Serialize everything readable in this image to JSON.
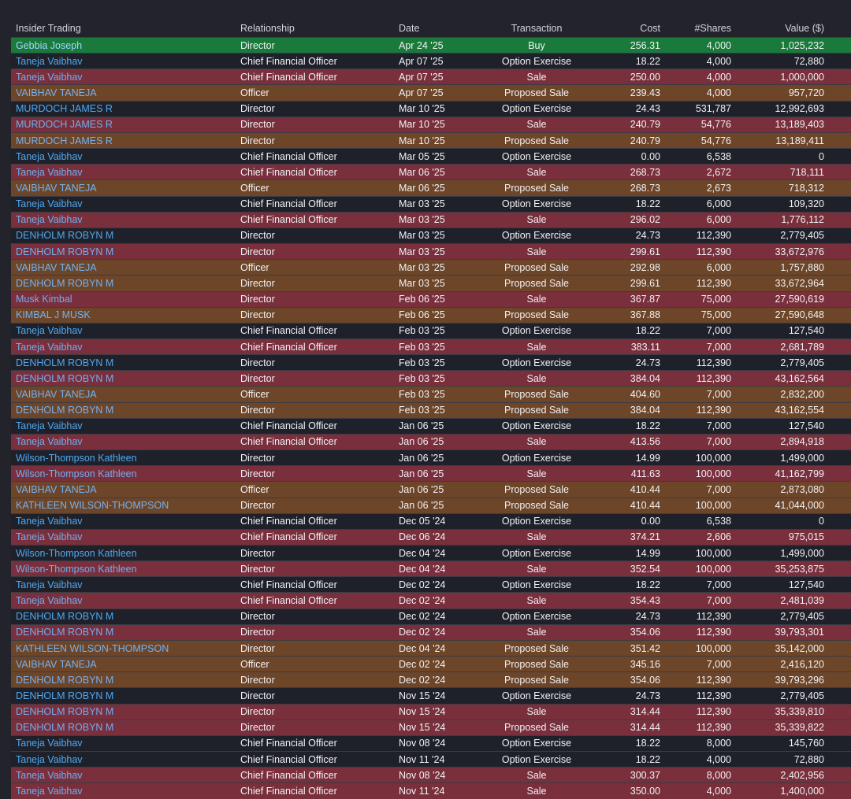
{
  "table": {
    "columns": [
      "Insider Trading",
      "Relationship",
      "Date",
      "Transaction",
      "Cost",
      "#Shares",
      "Value ($)"
    ],
    "rows": [
      {
        "name": "Gebbia Joseph",
        "rel": "Director",
        "date": "Apr 24 '25",
        "tx": "Buy",
        "cost": "256.31",
        "shares": "4,000",
        "value": "1,025,232",
        "kind": "buy"
      },
      {
        "name": "Taneja Vaibhav",
        "rel": "Chief Financial Officer",
        "date": "Apr 07 '25",
        "tx": "Option Exercise",
        "cost": "18.22",
        "shares": "4,000",
        "value": "72,880",
        "kind": "option"
      },
      {
        "name": "Taneja Vaibhav",
        "rel": "Chief Financial Officer",
        "date": "Apr 07 '25",
        "tx": "Sale",
        "cost": "250.00",
        "shares": "4,000",
        "value": "1,000,000",
        "kind": "sale"
      },
      {
        "name": "VAIBHAV TANEJA",
        "rel": "Officer",
        "date": "Apr 07 '25",
        "tx": "Proposed Sale",
        "cost": "239.43",
        "shares": "4,000",
        "value": "957,720",
        "kind": "proposed"
      },
      {
        "name": "MURDOCH JAMES R",
        "rel": "Director",
        "date": "Mar 10 '25",
        "tx": "Option Exercise",
        "cost": "24.43",
        "shares": "531,787",
        "value": "12,992,693",
        "kind": "option"
      },
      {
        "name": "MURDOCH JAMES R",
        "rel": "Director",
        "date": "Mar 10 '25",
        "tx": "Sale",
        "cost": "240.79",
        "shares": "54,776",
        "value": "13,189,403",
        "kind": "sale"
      },
      {
        "name": "MURDOCH JAMES R",
        "rel": "Director",
        "date": "Mar 10 '25",
        "tx": "Proposed Sale",
        "cost": "240.79",
        "shares": "54,776",
        "value": "13,189,411",
        "kind": "proposed"
      },
      {
        "name": "Taneja Vaibhav",
        "rel": "Chief Financial Officer",
        "date": "Mar 05 '25",
        "tx": "Option Exercise",
        "cost": "0.00",
        "shares": "6,538",
        "value": "0",
        "kind": "option"
      },
      {
        "name": "Taneja Vaibhav",
        "rel": "Chief Financial Officer",
        "date": "Mar 06 '25",
        "tx": "Sale",
        "cost": "268.73",
        "shares": "2,672",
        "value": "718,111",
        "kind": "sale"
      },
      {
        "name": "VAIBHAV TANEJA",
        "rel": "Officer",
        "date": "Mar 06 '25",
        "tx": "Proposed Sale",
        "cost": "268.73",
        "shares": "2,673",
        "value": "718,312",
        "kind": "proposed"
      },
      {
        "name": "Taneja Vaibhav",
        "rel": "Chief Financial Officer",
        "date": "Mar 03 '25",
        "tx": "Option Exercise",
        "cost": "18.22",
        "shares": "6,000",
        "value": "109,320",
        "kind": "option"
      },
      {
        "name": "Taneja Vaibhav",
        "rel": "Chief Financial Officer",
        "date": "Mar 03 '25",
        "tx": "Sale",
        "cost": "296.02",
        "shares": "6,000",
        "value": "1,776,112",
        "kind": "sale"
      },
      {
        "name": "DENHOLM ROBYN M",
        "rel": "Director",
        "date": "Mar 03 '25",
        "tx": "Option Exercise",
        "cost": "24.73",
        "shares": "112,390",
        "value": "2,779,405",
        "kind": "option"
      },
      {
        "name": "DENHOLM ROBYN M",
        "rel": "Director",
        "date": "Mar 03 '25",
        "tx": "Sale",
        "cost": "299.61",
        "shares": "112,390",
        "value": "33,672,976",
        "kind": "sale"
      },
      {
        "name": "VAIBHAV TANEJA",
        "rel": "Officer",
        "date": "Mar 03 '25",
        "tx": "Proposed Sale",
        "cost": "292.98",
        "shares": "6,000",
        "value": "1,757,880",
        "kind": "proposed"
      },
      {
        "name": "DENHOLM ROBYN M",
        "rel": "Director",
        "date": "Mar 03 '25",
        "tx": "Proposed Sale",
        "cost": "299.61",
        "shares": "112,390",
        "value": "33,672,964",
        "kind": "proposed"
      },
      {
        "name": "Musk Kimbal",
        "rel": "Director",
        "date": "Feb 06 '25",
        "tx": "Sale",
        "cost": "367.87",
        "shares": "75,000",
        "value": "27,590,619",
        "kind": "sale"
      },
      {
        "name": "KIMBAL J MUSK",
        "rel": "Director",
        "date": "Feb 06 '25",
        "tx": "Proposed Sale",
        "cost": "367.88",
        "shares": "75,000",
        "value": "27,590,648",
        "kind": "proposed"
      },
      {
        "name": "Taneja Vaibhav",
        "rel": "Chief Financial Officer",
        "date": "Feb 03 '25",
        "tx": "Option Exercise",
        "cost": "18.22",
        "shares": "7,000",
        "value": "127,540",
        "kind": "option"
      },
      {
        "name": "Taneja Vaibhav",
        "rel": "Chief Financial Officer",
        "date": "Feb 03 '25",
        "tx": "Sale",
        "cost": "383.11",
        "shares": "7,000",
        "value": "2,681,789",
        "kind": "sale"
      },
      {
        "name": "DENHOLM ROBYN M",
        "rel": "Director",
        "date": "Feb 03 '25",
        "tx": "Option Exercise",
        "cost": "24.73",
        "shares": "112,390",
        "value": "2,779,405",
        "kind": "option"
      },
      {
        "name": "DENHOLM ROBYN M",
        "rel": "Director",
        "date": "Feb 03 '25",
        "tx": "Sale",
        "cost": "384.04",
        "shares": "112,390",
        "value": "43,162,564",
        "kind": "sale"
      },
      {
        "name": "VAIBHAV TANEJA",
        "rel": "Officer",
        "date": "Feb 03 '25",
        "tx": "Proposed Sale",
        "cost": "404.60",
        "shares": "7,000",
        "value": "2,832,200",
        "kind": "proposed"
      },
      {
        "name": "DENHOLM ROBYN M",
        "rel": "Director",
        "date": "Feb 03 '25",
        "tx": "Proposed Sale",
        "cost": "384.04",
        "shares": "112,390",
        "value": "43,162,554",
        "kind": "proposed"
      },
      {
        "name": "Taneja Vaibhav",
        "rel": "Chief Financial Officer",
        "date": "Jan 06 '25",
        "tx": "Option Exercise",
        "cost": "18.22",
        "shares": "7,000",
        "value": "127,540",
        "kind": "option"
      },
      {
        "name": "Taneja Vaibhav",
        "rel": "Chief Financial Officer",
        "date": "Jan 06 '25",
        "tx": "Sale",
        "cost": "413.56",
        "shares": "7,000",
        "value": "2,894,918",
        "kind": "sale"
      },
      {
        "name": "Wilson-Thompson Kathleen",
        "rel": "Director",
        "date": "Jan 06 '25",
        "tx": "Option Exercise",
        "cost": "14.99",
        "shares": "100,000",
        "value": "1,499,000",
        "kind": "option"
      },
      {
        "name": "Wilson-Thompson Kathleen",
        "rel": "Director",
        "date": "Jan 06 '25",
        "tx": "Sale",
        "cost": "411.63",
        "shares": "100,000",
        "value": "41,162,799",
        "kind": "sale"
      },
      {
        "name": "VAIBHAV TANEJA",
        "rel": "Officer",
        "date": "Jan 06 '25",
        "tx": "Proposed Sale",
        "cost": "410.44",
        "shares": "7,000",
        "value": "2,873,080",
        "kind": "proposed"
      },
      {
        "name": "KATHLEEN WILSON-THOMPSON",
        "rel": "Director",
        "date": "Jan 06 '25",
        "tx": "Proposed Sale",
        "cost": "410.44",
        "shares": "100,000",
        "value": "41,044,000",
        "kind": "proposed"
      },
      {
        "name": "Taneja Vaibhav",
        "rel": "Chief Financial Officer",
        "date": "Dec 05 '24",
        "tx": "Option Exercise",
        "cost": "0.00",
        "shares": "6,538",
        "value": "0",
        "kind": "option"
      },
      {
        "name": "Taneja Vaibhav",
        "rel": "Chief Financial Officer",
        "date": "Dec 06 '24",
        "tx": "Sale",
        "cost": "374.21",
        "shares": "2,606",
        "value": "975,015",
        "kind": "sale"
      },
      {
        "name": "Wilson-Thompson Kathleen",
        "rel": "Director",
        "date": "Dec 04 '24",
        "tx": "Option Exercise",
        "cost": "14.99",
        "shares": "100,000",
        "value": "1,499,000",
        "kind": "option"
      },
      {
        "name": "Wilson-Thompson Kathleen",
        "rel": "Director",
        "date": "Dec 04 '24",
        "tx": "Sale",
        "cost": "352.54",
        "shares": "100,000",
        "value": "35,253,875",
        "kind": "sale"
      },
      {
        "name": "Taneja Vaibhav",
        "rel": "Chief Financial Officer",
        "date": "Dec 02 '24",
        "tx": "Option Exercise",
        "cost": "18.22",
        "shares": "7,000",
        "value": "127,540",
        "kind": "option"
      },
      {
        "name": "Taneja Vaibhav",
        "rel": "Chief Financial Officer",
        "date": "Dec 02 '24",
        "tx": "Sale",
        "cost": "354.43",
        "shares": "7,000",
        "value": "2,481,039",
        "kind": "sale"
      },
      {
        "name": "DENHOLM ROBYN M",
        "rel": "Director",
        "date": "Dec 02 '24",
        "tx": "Option Exercise",
        "cost": "24.73",
        "shares": "112,390",
        "value": "2,779,405",
        "kind": "option"
      },
      {
        "name": "DENHOLM ROBYN M",
        "rel": "Director",
        "date": "Dec 02 '24",
        "tx": "Sale",
        "cost": "354.06",
        "shares": "112,390",
        "value": "39,793,301",
        "kind": "sale"
      },
      {
        "name": "KATHLEEN WILSON-THOMPSON",
        "rel": "Director",
        "date": "Dec 04 '24",
        "tx": "Proposed Sale",
        "cost": "351.42",
        "shares": "100,000",
        "value": "35,142,000",
        "kind": "proposed"
      },
      {
        "name": "VAIBHAV TANEJA",
        "rel": "Officer",
        "date": "Dec 02 '24",
        "tx": "Proposed Sale",
        "cost": "345.16",
        "shares": "7,000",
        "value": "2,416,120",
        "kind": "proposed"
      },
      {
        "name": "DENHOLM ROBYN M",
        "rel": "Director",
        "date": "Dec 02 '24",
        "tx": "Proposed Sale",
        "cost": "354.06",
        "shares": "112,390",
        "value": "39,793,296",
        "kind": "proposed"
      },
      {
        "name": "DENHOLM ROBYN M",
        "rel": "Director",
        "date": "Nov 15 '24",
        "tx": "Option Exercise",
        "cost": "24.73",
        "shares": "112,390",
        "value": "2,779,405",
        "kind": "option"
      },
      {
        "name": "DENHOLM ROBYN M",
        "rel": "Director",
        "date": "Nov 15 '24",
        "tx": "Sale",
        "cost": "314.44",
        "shares": "112,390",
        "value": "35,339,810",
        "kind": "sale"
      },
      {
        "name": "DENHOLM ROBYN M",
        "rel": "Director",
        "date": "Nov 15 '24",
        "tx": "Proposed Sale",
        "cost": "314.44",
        "shares": "112,390",
        "value": "35,339,822",
        "kind": "sale"
      },
      {
        "name": "Taneja Vaibhav",
        "rel": "Chief Financial Officer",
        "date": "Nov 08 '24",
        "tx": "Option Exercise",
        "cost": "18.22",
        "shares": "8,000",
        "value": "145,760",
        "kind": "option"
      },
      {
        "name": "Taneja Vaibhav",
        "rel": "Chief Financial Officer",
        "date": "Nov 11 '24",
        "tx": "Option Exercise",
        "cost": "18.22",
        "shares": "4,000",
        "value": "72,880",
        "kind": "option"
      },
      {
        "name": "Taneja Vaibhav",
        "rel": "Chief Financial Officer",
        "date": "Nov 08 '24",
        "tx": "Sale",
        "cost": "300.37",
        "shares": "8,000",
        "value": "2,402,956",
        "kind": "sale"
      },
      {
        "name": "Taneja Vaibhav",
        "rel": "Chief Financial Officer",
        "date": "Nov 11 '24",
        "tx": "Sale",
        "cost": "350.00",
        "shares": "4,000",
        "value": "1,400,000",
        "kind": "sale"
      }
    ]
  },
  "colors": {
    "background": "#22232b",
    "buy": "#1a7a3c",
    "sale": "#7a2f3c",
    "proposed": "#6d4528",
    "option": "#1f212a",
    "link": "#4ea8f0"
  }
}
